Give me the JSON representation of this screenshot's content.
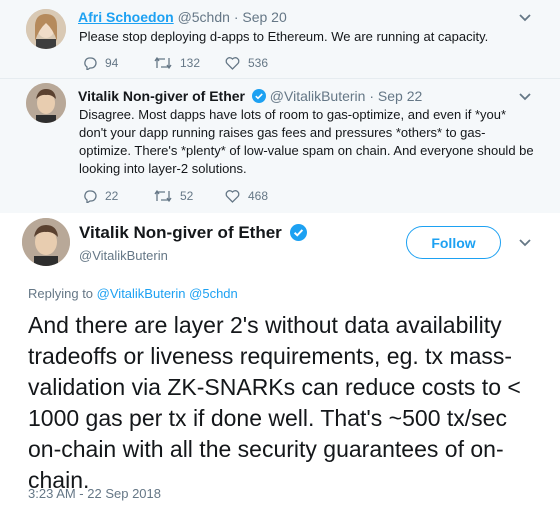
{
  "tweets": [
    {
      "name": "Afri Schoedon",
      "handle": "@5chdn",
      "date": "· Sep 20",
      "text": "Please stop deploying d-apps to Ethereum. We are running at capacity.",
      "replies": "94",
      "retweets": "132",
      "likes": "536"
    },
    {
      "name": "Vitalik Non-giver of Ether",
      "handle": "@VitalikButerin",
      "date": "· Sep 22",
      "text": "Disagree. Most dapps have lots of room to gas-optimize, and even if *you* don't your dapp running raises gas fees and pressures *others* to gas-optimize. There's *plenty* of low-value spam on chain. And everyone should be looking into layer-2 solutions.",
      "replies": "22",
      "retweets": "52",
      "likes": "468"
    }
  ],
  "main_tweet": {
    "name": "Vitalik Non-giver of Ether",
    "handle": "@VitalikButerin",
    "follow_label": "Follow",
    "replying_prefix": "Replying to",
    "replying_to_1": "@VitalikButerin",
    "replying_to_2": "@5chdn",
    "text": "And there are layer 2's without data availability tradeoffs or liveness requirements, eg. tx mass-validation via ZK-SNARKs can reduce costs to < 1000 gas per tx if done well. That's ~500 tx/sec on-chain with all the security guarantees of on-chain.",
    "timestamp": "3:23 AM - 22 Sep 2018"
  },
  "icons": {
    "reply": "reply-icon",
    "retweet": "retweet-icon",
    "like": "heart-icon",
    "verified": "verified-badge-icon",
    "menu": "chevron-down-icon"
  },
  "colors": {
    "accent": "#1da1f2",
    "muted": "#657786",
    "thread_bg": "#f5f8fa",
    "text": "#14171a"
  }
}
